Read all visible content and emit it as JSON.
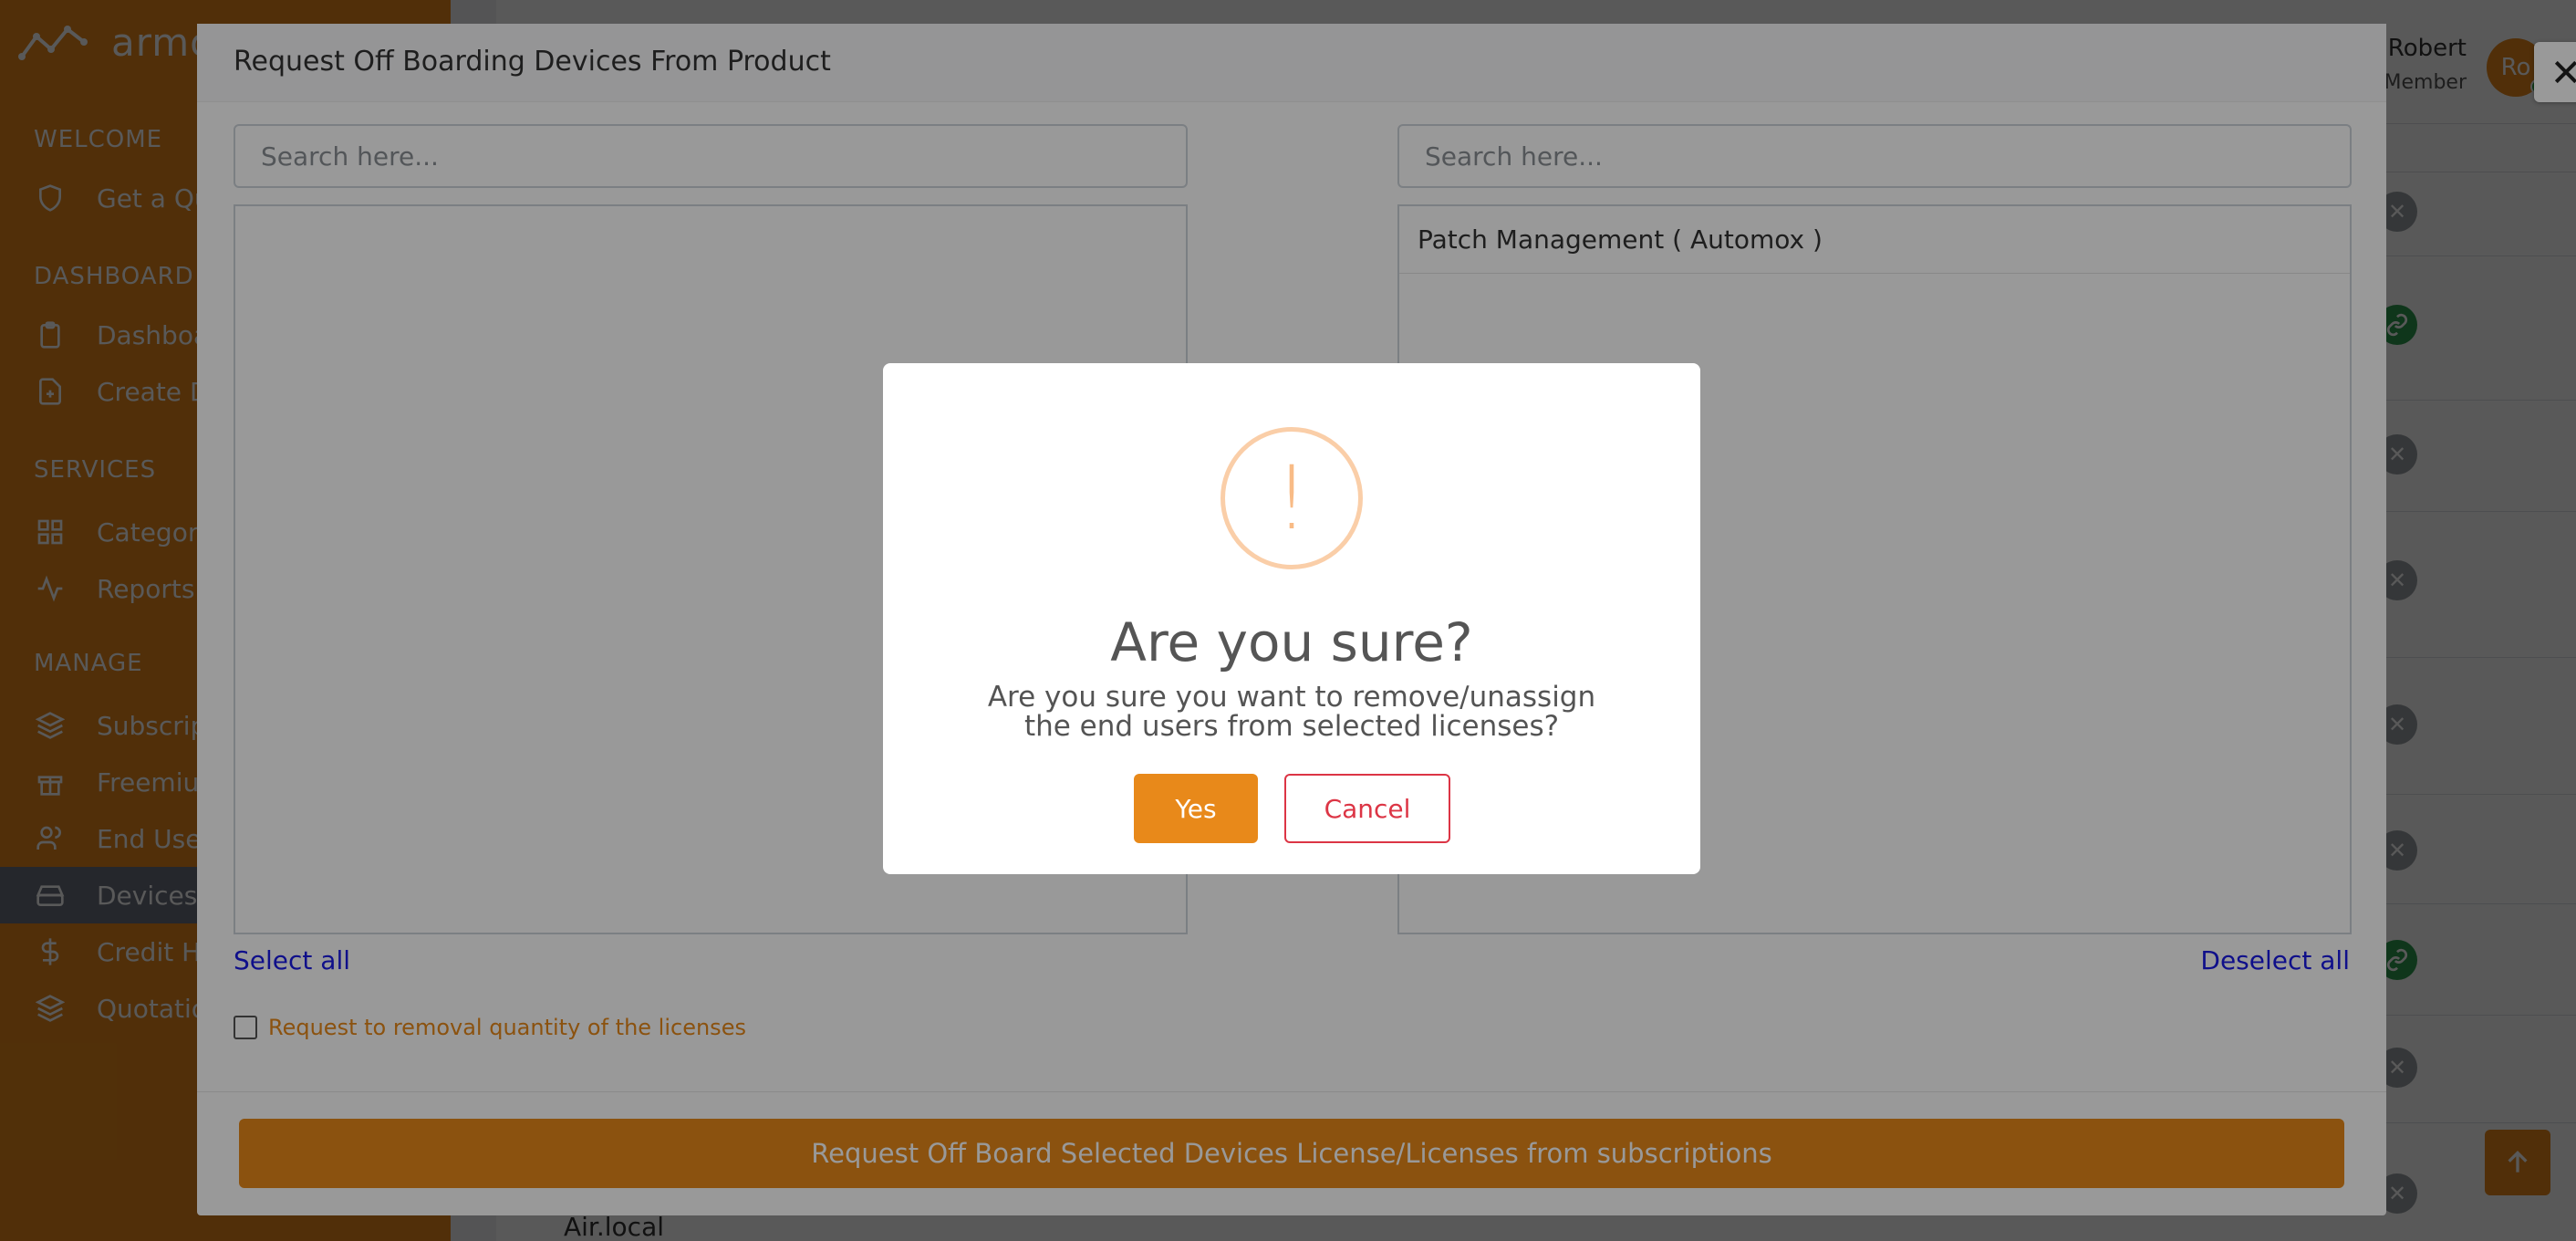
{
  "sidebar": {
    "logo_text": "armor",
    "sections": [
      {
        "label": "WELCOME"
      },
      {
        "label": "DASHBOARD"
      },
      {
        "label": "SERVICES"
      },
      {
        "label": "MANAGE"
      }
    ],
    "items": [
      {
        "label": "Get a Quote",
        "icon": "shield-icon"
      },
      {
        "label": "Dashboard",
        "icon": "clipboard-icon"
      },
      {
        "label": "Create Dashboard",
        "icon": "file-plus-icon"
      },
      {
        "label": "Categories",
        "icon": "grid-icon"
      },
      {
        "label": "Reports",
        "icon": "activity-icon"
      },
      {
        "label": "Subscriptions",
        "icon": "layers-icon"
      },
      {
        "label": "Freemium",
        "icon": "gift-icon"
      },
      {
        "label": "End Users",
        "icon": "users-icon"
      },
      {
        "label": "Devices",
        "icon": "hard-drive-icon"
      },
      {
        "label": "Credit History",
        "icon": "dollar-icon"
      },
      {
        "label": "Quotations",
        "icon": "layers-icon"
      }
    ]
  },
  "header": {
    "user_name": "Robert",
    "user_role": "Member",
    "avatar_initials": "Ro"
  },
  "table": {
    "bottom_cell": "Air.local"
  },
  "modal": {
    "title": "Request Off Boarding Devices From Product",
    "left_search_placeholder": "Search here...",
    "right_search_placeholder": "Search here...",
    "right_list": [
      "Patch Management ( Automox )"
    ],
    "select_all": "Select all",
    "deselect_all": "Deselect all",
    "checkbox_label": "Request to removal quantity of the licenses",
    "submit_label": "Request Off Board Selected Devices License/Licenses from subscriptions"
  },
  "dialog": {
    "icon_glyph": "!",
    "title": "Are you sure?",
    "text": "Are you sure you want to remove/unassign the end users from selected licenses?",
    "yes_label": "Yes",
    "cancel_label": "Cancel"
  },
  "colors": {
    "brand_orange": "#e8891a",
    "cancel_red": "#dc3545",
    "link_blue": "#1a1ae6",
    "warn_orange": "#f8bb86"
  }
}
